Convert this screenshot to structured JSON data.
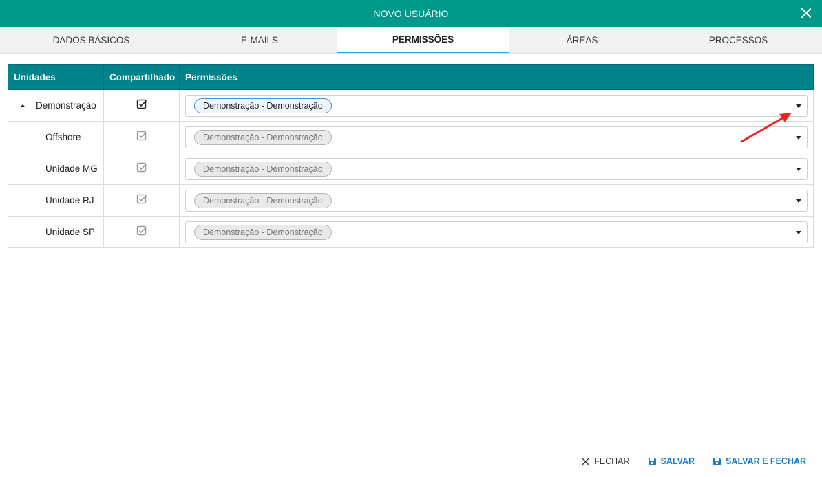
{
  "dialog": {
    "title": "NOVO USUÁRIO"
  },
  "tabs": [
    {
      "label": "DADOS BÁSICOS"
    },
    {
      "label": "E-MAILS"
    },
    {
      "label": "PERMISSÕES"
    },
    {
      "label": "ÁREAS"
    },
    {
      "label": "PROCESSOS"
    }
  ],
  "active_tab": "PERMISSÕES",
  "table": {
    "headers": [
      "Unidades",
      "Compartilhado",
      "Permissões"
    ],
    "rows": [
      {
        "unit": "Demonstração",
        "shared": true,
        "permission": "Demonstração - Demonstração",
        "enabled": true,
        "expanded": true
      },
      {
        "unit": "Offshore",
        "shared": true,
        "permission": "Demonstração - Demonstração",
        "enabled": false
      },
      {
        "unit": "Unidade MG",
        "shared": true,
        "permission": "Demonstração - Demonstração",
        "enabled": false
      },
      {
        "unit": "Unidade RJ",
        "shared": true,
        "permission": "Demonstração - Demonstração",
        "enabled": false
      },
      {
        "unit": "Unidade SP",
        "shared": true,
        "permission": "Demonstração - Demonstração",
        "enabled": false
      }
    ]
  },
  "footer": {
    "close_label": "FECHAR",
    "save_label": "SALVAR",
    "save_close_label": "SALVAR E FECHAR"
  },
  "colors": {
    "header_teal": "#00998a",
    "table_header": "#00838a",
    "tab_underline": "#29a7d6",
    "action_blue": "#1a7fc4",
    "annotation_red": "#e8251f"
  }
}
